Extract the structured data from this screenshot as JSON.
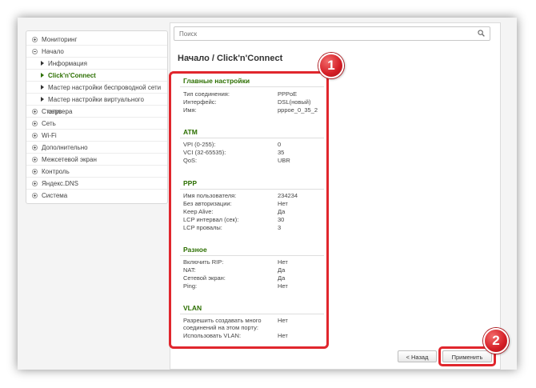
{
  "search": {
    "placeholder": "Поиск"
  },
  "sidebar": {
    "items": [
      {
        "label": "Мониторинг"
      },
      {
        "label": "Начало"
      },
      {
        "label": "Информация"
      },
      {
        "label": "Click'n'Connect"
      },
      {
        "label": "Мастер настройки беспроводной сети"
      },
      {
        "label": "Мастер настройки виртуального сервера"
      },
      {
        "label": "Статус"
      },
      {
        "label": "Сеть"
      },
      {
        "label": "Wi-Fi"
      },
      {
        "label": "Дополнительно"
      },
      {
        "label": "Межсетевой экран"
      },
      {
        "label": "Контроль"
      },
      {
        "label": "Яндекс.DNS"
      },
      {
        "label": "Система"
      }
    ]
  },
  "page": {
    "title": "Начало /  Click'n'Connect"
  },
  "sections": {
    "main": {
      "title": "Главные настройки",
      "rows": [
        {
          "label": "Тип соединения:",
          "value": "PPPoE"
        },
        {
          "label": "Интерфейс:",
          "value": "DSL(новый)"
        },
        {
          "label": "Имя:",
          "value": "pppoe_0_35_2"
        }
      ]
    },
    "atm": {
      "title": "ATM",
      "rows": [
        {
          "label": "VPI (0-255):",
          "value": "0"
        },
        {
          "label": "VCI (32-65535):",
          "value": "35"
        },
        {
          "label": "QoS:",
          "value": "UBR"
        }
      ]
    },
    "ppp": {
      "title": "PPP",
      "rows": [
        {
          "label": "Имя пользователя:",
          "value": "234234"
        },
        {
          "label": "Без авторизации:",
          "value": "Нет"
        },
        {
          "label": "Keep Alive:",
          "value": "Да"
        },
        {
          "label": "LCP интервал (сек):",
          "value": "30"
        },
        {
          "label": "LCP провалы:",
          "value": "3"
        }
      ]
    },
    "misc": {
      "title": "Разное",
      "rows": [
        {
          "label": "Включить RIP:",
          "value": "Нет"
        },
        {
          "label": "NAT:",
          "value": "Да"
        },
        {
          "label": "Сетевой экран:",
          "value": "Да"
        },
        {
          "label": "Ping:",
          "value": "Нет"
        }
      ]
    },
    "vlan": {
      "title": "VLAN",
      "rows": [
        {
          "label": "Разрешить создавать много соединений на этом порту:",
          "value": "Нет"
        },
        {
          "label": "Использовать VLAN:",
          "value": "Нет"
        }
      ]
    }
  },
  "buttons": {
    "back": "< Назад",
    "apply": "Применить"
  },
  "badges": {
    "one": "1",
    "two": "2"
  },
  "colors": {
    "accent_green": "#2c6f00",
    "highlight_red": "#e0262d"
  }
}
